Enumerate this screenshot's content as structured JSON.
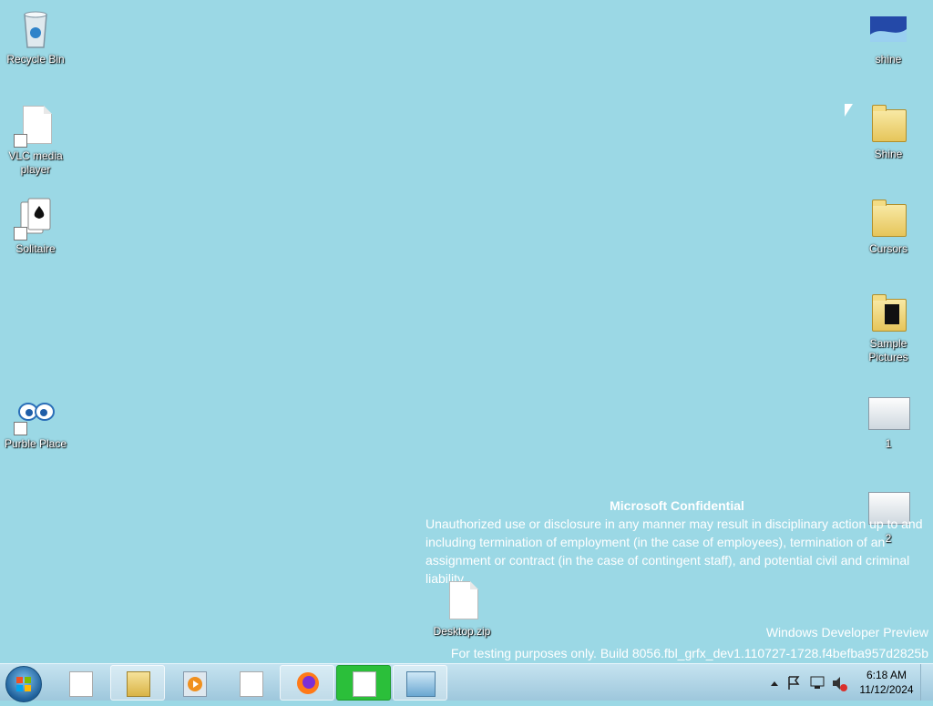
{
  "desktop": {
    "left_icons": [
      {
        "label": "Recycle Bin",
        "icon": "recycle-bin-icon"
      },
      {
        "label": "VLC media player",
        "icon": "file-icon"
      },
      {
        "label": "Solitaire",
        "icon": "solitaire-icon"
      },
      {
        "label": "Purble Place",
        "icon": "purble-place-icon"
      }
    ],
    "right_icons": [
      {
        "label": "shine",
        "icon": "image-icon"
      },
      {
        "label": "Shine",
        "icon": "folder-icon"
      },
      {
        "label": "Cursors",
        "icon": "folder-icon"
      },
      {
        "label": "Sample Pictures",
        "icon": "folder-icon"
      },
      {
        "label": "1",
        "icon": "image-icon"
      },
      {
        "label": "2",
        "icon": "image-icon"
      }
    ],
    "center_icon": {
      "label": "Desktop.zip",
      "icon": "file-icon"
    }
  },
  "watermark": {
    "title": "Microsoft Confidential",
    "body": "Unauthorized use or disclosure in any manner may result in disciplinary action up to and including termination of employment (in the case of employees), termination of an assignment or contract (in the case of contingent staff), and potential civil and criminal liability.",
    "product": "Windows Developer Preview",
    "build": "For testing purposes only. Build 8056.fbl_grfx_dev1.110727-1728.f4befba957d2825b"
  },
  "taskbar": {
    "items": [
      {
        "name": "document-icon"
      },
      {
        "name": "explorer-icon"
      },
      {
        "name": "media-player-icon"
      },
      {
        "name": "document-icon"
      },
      {
        "name": "firefox-icon"
      },
      {
        "name": "document-icon"
      },
      {
        "name": "control-panel-icon"
      }
    ],
    "clock": {
      "time": "6:18 AM",
      "date": "11/12/2024"
    }
  }
}
